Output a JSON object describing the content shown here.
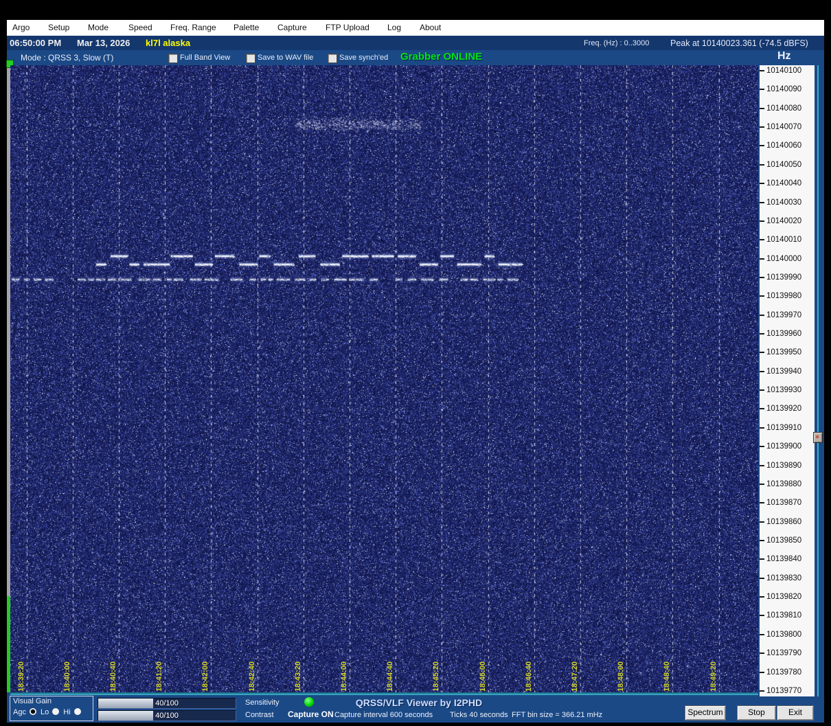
{
  "menu_bar": {
    "items": [
      "Argo",
      "Setup",
      "Mode",
      "Speed",
      "Freq. Range",
      "Palette",
      "Capture",
      "FTP Upload",
      "Log",
      "About"
    ]
  },
  "status_bar": {
    "time": "06:50:00 PM",
    "date": "Mar 13, 2026",
    "callsign": "kl7l alaska",
    "freq_range": "Freq. (Hz) :  0..3000",
    "peak": "Peak at 10140023.361 (-74.5 dBFS)"
  },
  "mode_bar": {
    "mode": "Mode : QRSS 3, Slow  (T)",
    "checkboxes": [
      {
        "label": "Full Band View",
        "checked": false
      },
      {
        "label": "Save to WAV file",
        "checked": false
      },
      {
        "label": "Save synch'ed",
        "checked": false
      }
    ],
    "grabber_status": "Grabber ONLINE",
    "grabber_color": "#00e418"
  },
  "freq_scale": {
    "unit": "Hz",
    "labels": [
      "10140100",
      "10140090",
      "10140080",
      "10140070",
      "10140060",
      "10140050",
      "10140040",
      "10140030",
      "10140020",
      "10140010",
      "10140000",
      "10139990",
      "10139980",
      "10139970",
      "10139960",
      "10139950",
      "10139940",
      "10139930",
      "10139920",
      "10139910",
      "10139900",
      "10139890",
      "10139880",
      "10139870",
      "10139860",
      "10139850",
      "10139840",
      "10139830",
      "10139820",
      "10139810",
      "10139800",
      "10139790",
      "10139780",
      "10139770"
    ]
  },
  "waterfall": {
    "time_ticks": [
      "18:39:20",
      "18:40:00",
      "18:40:40",
      "18:41:20",
      "18:42:00",
      "18:42:40",
      "18:43:20",
      "18:44:00",
      "18:44:40",
      "18:45:20",
      "18:46:00",
      "18:46:40",
      "18:47:20",
      "18:48:00",
      "18:48:40",
      "18:49:20"
    ],
    "tick_label_color": "#d4d428",
    "signals": [
      {
        "name": "weak-fuzzy-trace",
        "approx_freq_hz": "10140070",
        "time_span": "18:43:10 to 18:44:50",
        "appearance": "faint fuzzy speckle band"
      },
      {
        "name": "fsk-cw-trace",
        "approx_freq_hz": "10139996 to 10140001",
        "time_span": "18:40:30 to 18:46:30",
        "appearance": "bright two-tone FSK dashes"
      },
      {
        "name": "cw-dash-trace",
        "approx_freq_hz": "10139990",
        "time_span": "18:39:00 to 18:46:30",
        "appearance": "broken dotted dashes"
      }
    ]
  },
  "bottom_bar": {
    "visual_gain": {
      "label": "Visual Gain",
      "options": [
        {
          "label": "Agc",
          "selected": true
        },
        {
          "label": "Lo",
          "selected": false
        },
        {
          "label": "Hi",
          "selected": false
        }
      ]
    },
    "sensitivity": {
      "label": "Sensitivity",
      "value": "40/100",
      "fraction": 0.4
    },
    "contrast": {
      "label": "Contrast",
      "value": "40/100",
      "fraction": 0.4
    },
    "capture_led_color": "#00d800",
    "capture_status": "Capture ON",
    "title": "QRSS/VLF Viewer by I2PHD",
    "capture_interval": "Capture interval 600 seconds",
    "ticks_info": "Ticks  40 seconds",
    "fft_info": "FFT bin size = 366.21 mHz",
    "buttons": [
      "Spectrum",
      "Stop",
      "Exit"
    ]
  }
}
